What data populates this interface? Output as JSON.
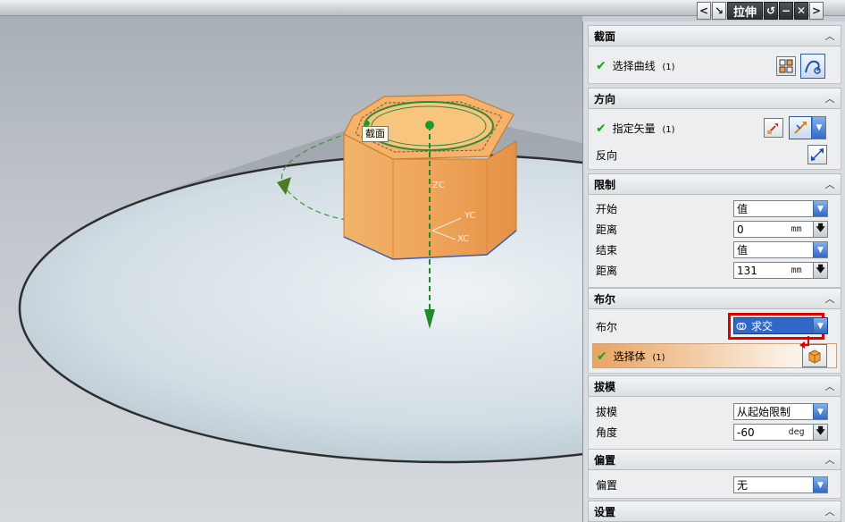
{
  "window": {
    "title": "拉伸",
    "buttons": [
      "<",
      "↘",
      "拉伸",
      "↺",
      "−",
      "✕",
      ">"
    ]
  },
  "viewport": {
    "section_tag": "截面",
    "axis_labels": {
      "zc": "ZC",
      "yc": "YC",
      "xc": "XC"
    }
  },
  "dialog": {
    "section": {
      "header": "截面",
      "select_curve_label": "选择曲线",
      "select_curve_count": "(1)"
    },
    "direction": {
      "header": "方向",
      "specify_vector_label": "指定矢量",
      "specify_vector_count": "(1)",
      "reverse_label": "反向"
    },
    "limits": {
      "header": "限制",
      "start_label": "开始",
      "start_value": "值",
      "start_distance_label": "距离",
      "start_distance_value": "0",
      "start_distance_unit": "mm",
      "end_label": "结束",
      "end_value": "值",
      "end_distance_label": "距离",
      "end_distance_value": "131",
      "end_distance_unit": "mm"
    },
    "boolean": {
      "header": "布尔",
      "boolean_label": "布尔",
      "boolean_value": "求交",
      "select_body_label": "选择体",
      "select_body_count": "(1)"
    },
    "draft": {
      "header": "拔模",
      "draft_label": "拔模",
      "draft_value": "从起始限制",
      "angle_label": "角度",
      "angle_value": "-60",
      "angle_unit": "deg"
    },
    "offset": {
      "header": "偏置",
      "offset_label": "偏置",
      "offset_value": "无"
    },
    "settings": {
      "header": "设置"
    }
  },
  "colors": {
    "accent_blue": "#2f68c8",
    "highlight_red": "#e00000",
    "check_green": "#1aa31a",
    "body_orange": "#f2a85a"
  }
}
